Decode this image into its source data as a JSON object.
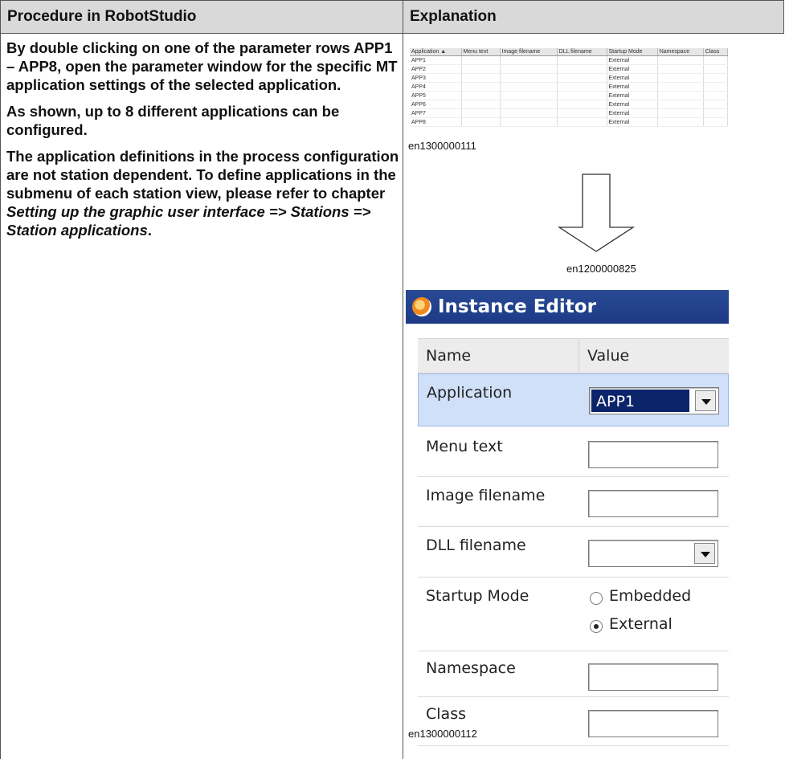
{
  "headers": {
    "left": "Procedure in RobotStudio",
    "right": "Explanation"
  },
  "procedure": {
    "p1": "By double clicking on one of the parameter rows APP1 – APP8, open the parameter window for the specific MT application settings of the selected application.",
    "p2": "As shown, up to 8 different applications can be configured.",
    "p3_start": "The application definitions in the process configuration are not station dependent. To define applications in the submenu of each station view, please refer to chapter ",
    "p3_italic": "Setting up the graphic user interface => Stations => Station applications",
    "p3_end": "."
  },
  "mini_table": {
    "columns": [
      "Application ▲",
      "Menu text",
      "Image filename",
      "DLL filename",
      "Startup Mode",
      "Namespace",
      "Class"
    ],
    "rows": [
      [
        "APP1",
        "",
        "",
        "",
        "External",
        "",
        ""
      ],
      [
        "APP2",
        "",
        "",
        "",
        "External",
        "",
        ""
      ],
      [
        "APP3",
        "",
        "",
        "",
        "External",
        "",
        ""
      ],
      [
        "APP4",
        "",
        "",
        "",
        "External",
        "",
        ""
      ],
      [
        "APP5",
        "",
        "",
        "",
        "External",
        "",
        ""
      ],
      [
        "APP6",
        "",
        "",
        "",
        "External",
        "",
        ""
      ],
      [
        "APP7",
        "",
        "",
        "",
        "External",
        "",
        ""
      ],
      [
        "APP8",
        "",
        "",
        "",
        "External",
        "",
        ""
      ]
    ]
  },
  "captions": {
    "c1": "en1300000111",
    "c2": "en1200000825",
    "c3": "en1300000112"
  },
  "instance_editor": {
    "title": "Instance Editor",
    "col_name": "Name",
    "col_value": "Value",
    "application_label": "Application",
    "application_value": "APP1",
    "menu_text_label": "Menu text",
    "image_filename_label": "Image filename",
    "dll_filename_label": "DLL filename",
    "startup_mode_label": "Startup Mode",
    "startup_opt1": "Embedded",
    "startup_opt2": "External",
    "startup_selected": "External",
    "namespace_label": "Namespace",
    "class_label": "Class"
  }
}
